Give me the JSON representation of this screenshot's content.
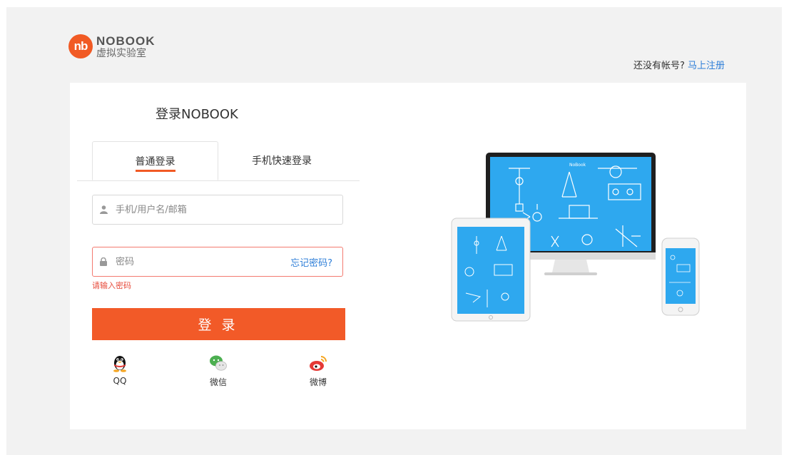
{
  "brand": {
    "mark": "nb",
    "name": "NOBOOK",
    "subtitle": "虚拟实验室"
  },
  "header": {
    "prompt": "还没有帐号?",
    "register_link": "马上注册"
  },
  "login": {
    "title": "登录NOBOOK",
    "tabs": [
      {
        "label": "普通登录",
        "active": true
      },
      {
        "label": "手机快速登录",
        "active": false
      }
    ],
    "username_placeholder": "手机/用户名/邮箱",
    "password_placeholder": "密码",
    "forgot_password": "忘记密码?",
    "error": "请输入密码",
    "submit": "登录",
    "social": [
      {
        "label": "QQ",
        "icon": "qq-penguin-icon"
      },
      {
        "label": "微信",
        "icon": "wechat-icon"
      },
      {
        "label": "微博",
        "icon": "weibo-icon"
      }
    ]
  },
  "colors": {
    "accent": "#f15a24",
    "link": "#2f7fd8",
    "error": "#e74c3c",
    "screen": "#2ea8ef",
    "background": "#f2f2f2"
  },
  "illustration": {
    "screen_label": "NoBook"
  }
}
